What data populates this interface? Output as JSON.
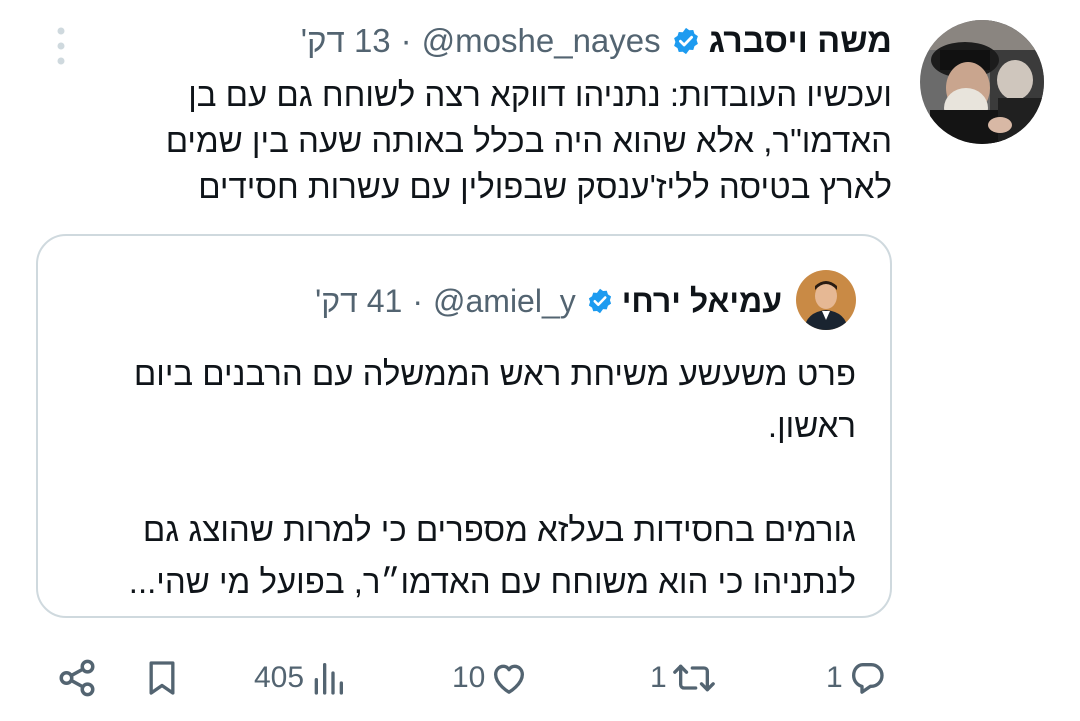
{
  "tweet": {
    "author_name": "משה ויסברג",
    "handle": "@moshe_nayes",
    "separator": "·",
    "time": "13 דק'",
    "text": "ועכשיו העובדות: נתניהו דווקא רצה לשוחח גם עם בן האדמו\"ר, אלא שהוא היה בכלל באותה שעה בין שמים לארץ בטיסה לליז'ענסק שבפולין עם עשרות חסידים",
    "verified": true
  },
  "quote": {
    "author_name": "עמיאל ירחי",
    "handle": "@amiel_y",
    "separator": "·",
    "time": "41 דק'",
    "text": "פרט משעשע משיחת ראש הממשלה עם הרבנים ביום ראשון.\n\nגורמים בחסידות בעלזא מספרים כי למרות שהוצג גם לנתניהו כי הוא משוחח עם האדמו״ר, בפועל מי שהי...",
    "verified": true
  },
  "actions": {
    "reply_count": "1",
    "retweet_count": "1",
    "like_count": "10",
    "views_count": "405"
  },
  "colors": {
    "text": "#0f1419",
    "secondary": "#536471",
    "verified": "#1d9bf0",
    "border": "#cfd9de"
  }
}
